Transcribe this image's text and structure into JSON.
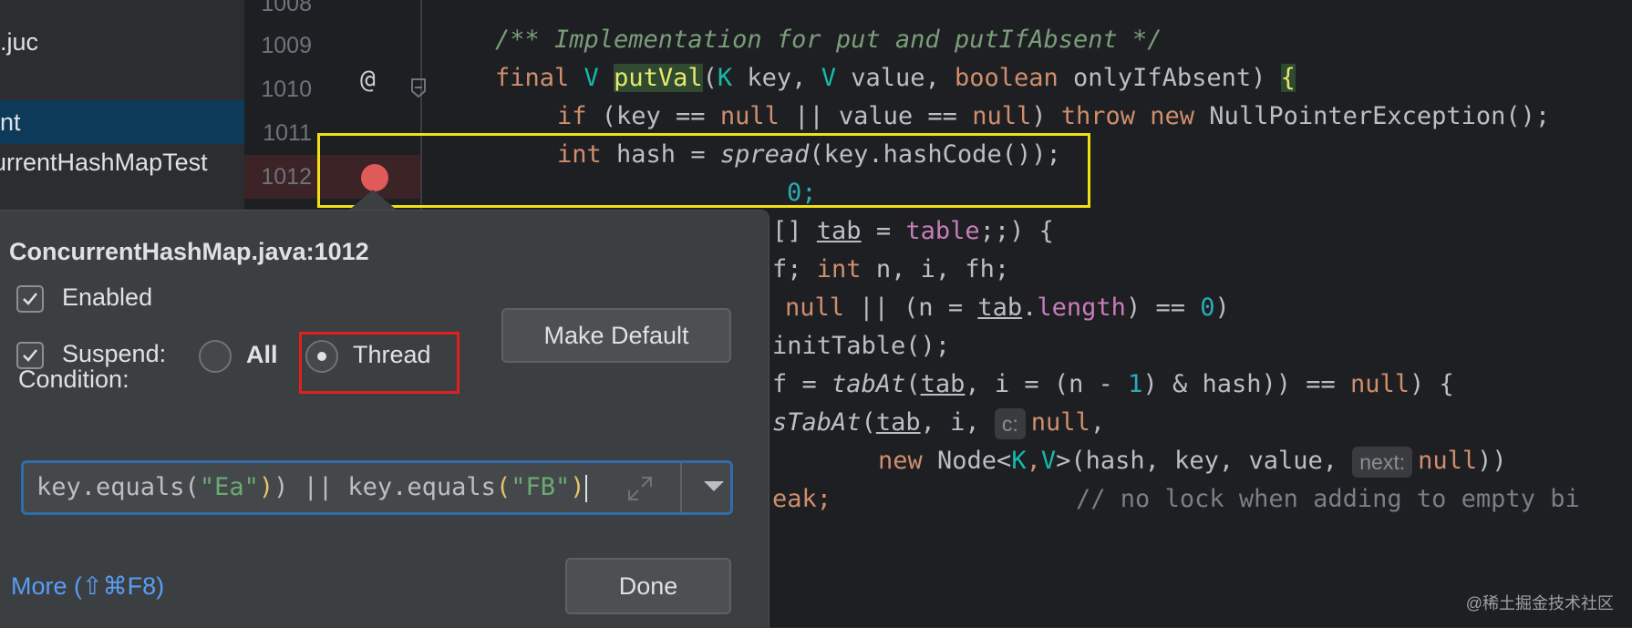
{
  "project_tree": {
    "items": [
      {
        "label": ".juc"
      },
      {
        "label": "nt"
      },
      {
        "label": "urrentHashMapTest"
      }
    ]
  },
  "editor": {
    "line_numbers": [
      "1008",
      "1009",
      "1010",
      "1011",
      "1012"
    ],
    "code": {
      "l1009": "/** Implementation for put and putIfAbsent */",
      "l1010_a": "final ",
      "l1010_v": "V ",
      "l1010_fn": "putVal",
      "l1010_b": "(",
      "l1010_k": "K",
      "l1010_c": " key, ",
      "l1010_v2": "V",
      "l1010_d": " value, ",
      "l1010_bool": "boolean",
      "l1010_e": " onlyIfAbsent) ",
      "l1010_brace": "{",
      "l1011_if": "if",
      "l1011_a": " (key == ",
      "l1011_null1": "null",
      "l1011_b": " || value == ",
      "l1011_null2": "null",
      "l1011_c": ") ",
      "l1011_throw": "throw new",
      "l1011_d": " NullPointerException();",
      "l1012_int": "int",
      "l1012_a": " hash = ",
      "l1012_spread": "spread",
      "l1012_b": "(key.hashCode());",
      "l1013": "0;",
      "l1014_a": "[] ",
      "l1014_tab": "tab",
      "l1014_b": " = ",
      "l1014_table": "table",
      "l1014_c": ";;) {",
      "l1015_a": "f; ",
      "l1015_int": "int",
      "l1015_b": " n, i, fh;",
      "l1016_null": "null",
      "l1016_a": " || (n = ",
      "l1016_tab": "tab",
      "l1016_dot": ".",
      "l1016_len": "length",
      "l1016_b": ") == ",
      "l1016_zero": "0",
      "l1016_c": ")",
      "l1017": "initTable();",
      "l1018_a": "f = ",
      "l1018_fn": "tabAt",
      "l1018_b": "(",
      "l1018_tab": "tab",
      "l1018_c": ", i = (n - ",
      "l1018_one": "1",
      "l1018_d": ") & hash)) == ",
      "l1018_null": "null",
      "l1018_e": ") {",
      "l1019_fn": "sTabAt",
      "l1019_a": "(",
      "l1019_tab": "tab",
      "l1019_b": ", i, ",
      "l1019_hint": "c:",
      "l1019_null": "null",
      "l1019_c": ",",
      "l1020_new": "new",
      "l1020_a": " Node<",
      "l1020_k": "K",
      "l1020_comma": ",",
      "l1020_v": "V",
      "l1020_b": ">(hash, key, value, ",
      "l1020_hint": "next:",
      "l1020_null": "null",
      "l1020_c": "))",
      "l1021_a": "eak;",
      "l1021_cm": "// no lock when adding to empty bi"
    }
  },
  "breakpoint_popup": {
    "title": "ConcurrentHashMap.java:1012",
    "enabled_label": "Enabled",
    "enabled_checked": true,
    "suspend_label": "Suspend:",
    "suspend_checked": true,
    "suspend_all_label": "All",
    "suspend_thread_label": "Thread",
    "suspend_selected": "Thread",
    "make_default_label": "Make Default",
    "condition_label": "Condition:",
    "condition": {
      "p1": "key.equals(",
      "s1": "\"Ea\"",
      "p2": ") || key.equals",
      "lp": "(",
      "s2": "\"FB\"",
      "rp": ")"
    },
    "more_label": "More (⇧⌘F8)",
    "done_label": "Done"
  },
  "watermark": "@稀土掘金技术社区",
  "colors": {
    "breakpoint": "#e15a5a",
    "highlight_yellow": "#f0e014",
    "highlight_red": "#e02020",
    "link": "#589df6"
  }
}
